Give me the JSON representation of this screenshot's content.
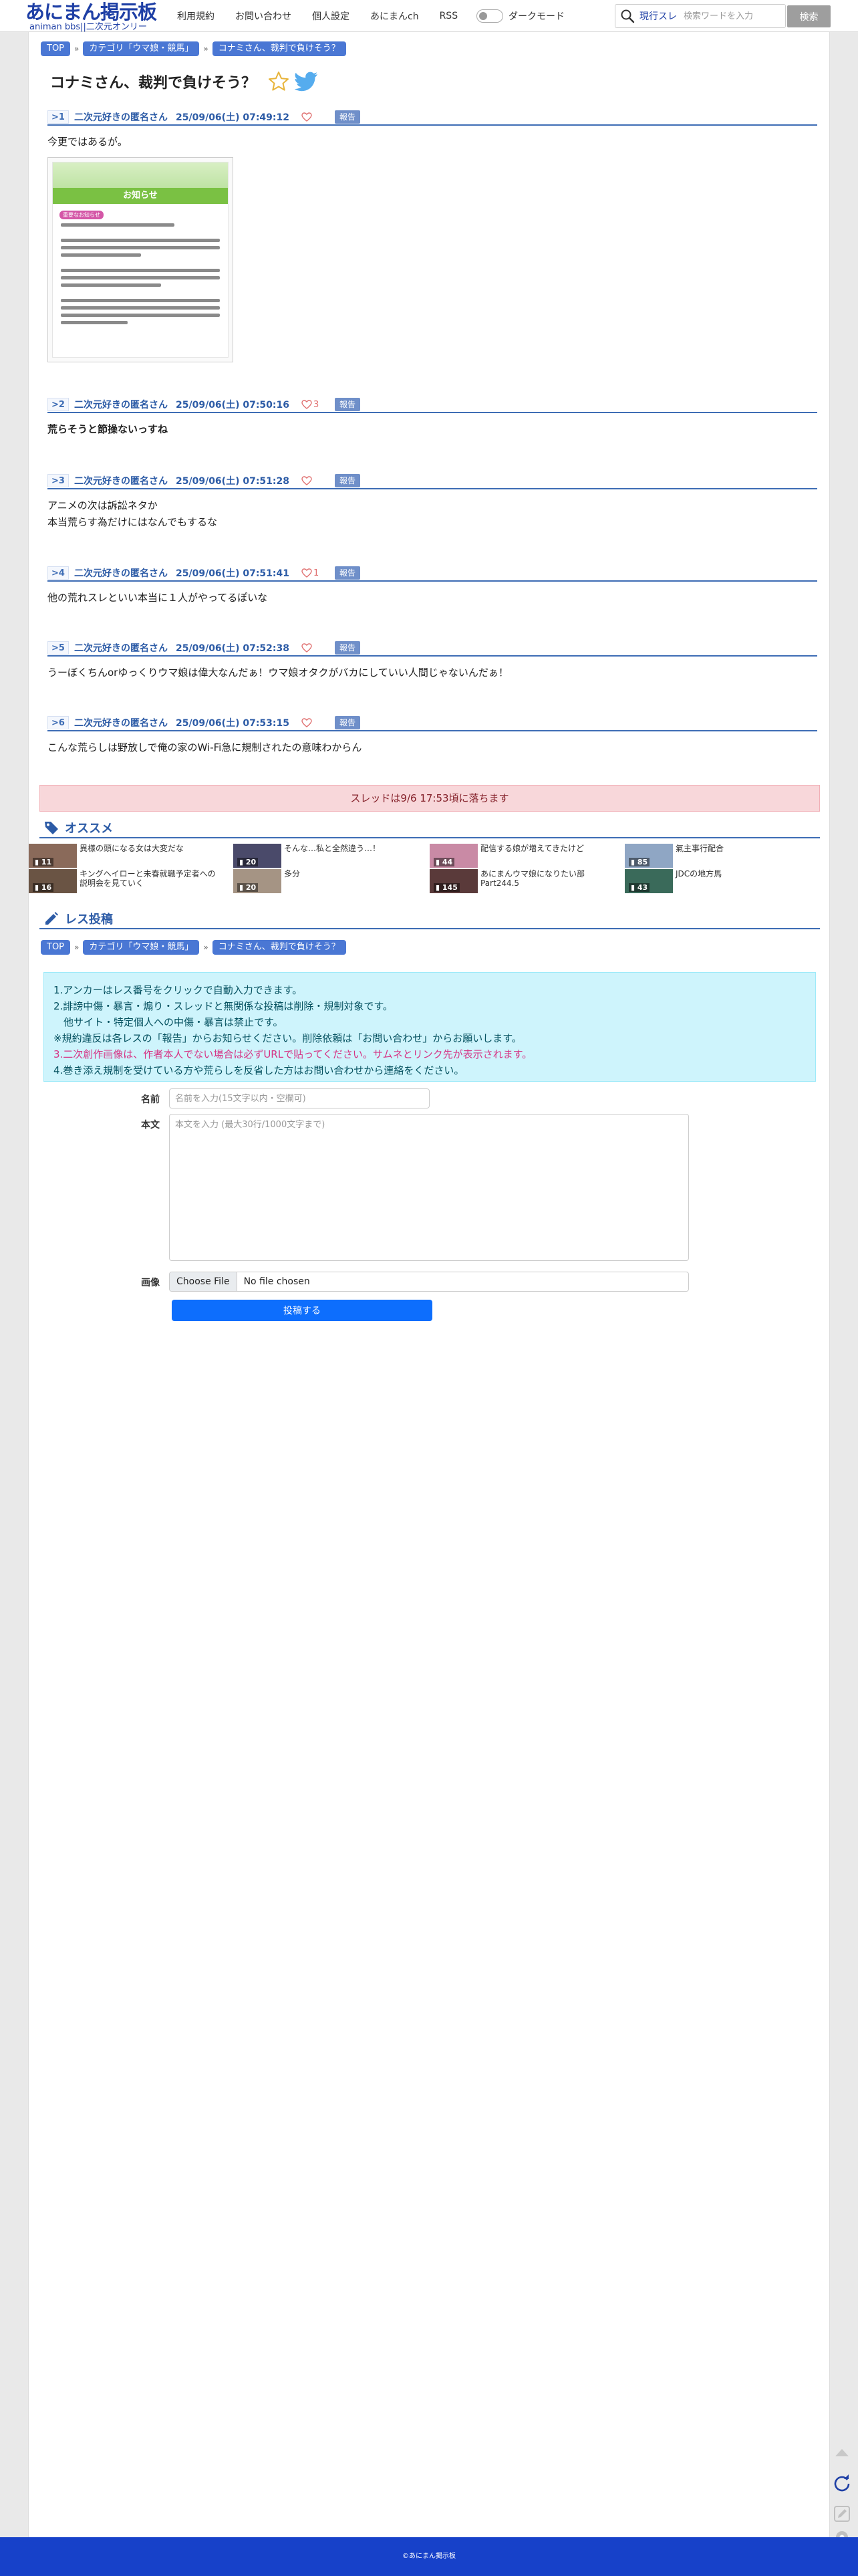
{
  "header": {
    "logo_main": "あにまん掲示板",
    "logo_sub": "animan bbs||二次元オンリー",
    "nav": [
      "利用規約",
      "お問い合わせ",
      "個人設定",
      "あにまんch",
      "RSS"
    ],
    "dark_mode_label": "ダークモード",
    "search_scope": "現行スレ",
    "search_placeholder": "検索ワードを入力",
    "search_button": "検索"
  },
  "breadcrumb": {
    "top": "TOP",
    "category": "カテゴリ「ウマ娘・競馬」",
    "thread": "コナミさん、裁判で負けそう？"
  },
  "thread_title": "コナミさん、裁判で負けそう？",
  "posts": [
    {
      "num": ">1",
      "name": "二次元好きの匿名さん",
      "date": "25/09/06(土) 07:49:12",
      "likes": "",
      "report": "報告",
      "body": "今更ではあるが。",
      "bold": false
    },
    {
      "num": ">2",
      "name": "二次元好きの匿名さん",
      "date": "25/09/06(土) 07:50:16",
      "likes": "3",
      "report": "報告",
      "body": "荒らそうと節操ないっすね",
      "bold": true
    },
    {
      "num": ">3",
      "name": "二次元好きの匿名さん",
      "date": "25/09/06(土) 07:51:28",
      "likes": "",
      "report": "報告",
      "body": "アニメの次は訴訟ネタか\n本当荒らす為だけにはなんでもするな",
      "bold": false
    },
    {
      "num": ">4",
      "name": "二次元好きの匿名さん",
      "date": "25/09/06(土) 07:51:41",
      "likes": "1",
      "report": "報告",
      "body": "他の荒れスレといい本当に１人がやってるぽいな",
      "bold": false
    },
    {
      "num": ">5",
      "name": "二次元好きの匿名さん",
      "date": "25/09/06(土) 07:52:38",
      "likes": "",
      "report": "報告",
      "body": "うーぼくちんorゆっくりウマ娘は偉大なんだぁ！ウマ娘オタクがバカにしていい人間じゃないんだぁ！",
      "bold": false
    },
    {
      "num": ">6",
      "name": "二次元好きの匿名さん",
      "date": "25/09/06(土) 07:53:15",
      "likes": "",
      "report": "報告",
      "body": "こんな荒らしは野放しで俺の家のWi-Fi急に規制されたの意味わからん",
      "bold": false
    }
  ],
  "attachment": {
    "banner": "お知らせ",
    "tag": "重要なお知らせ"
  },
  "notice": "スレッドは9/6 17:53頃に落ちます",
  "recommend": {
    "title": "オススメ",
    "items": [
      {
        "count": "11",
        "text": "異様の頭になる女は大変だな",
        "color": "#8a6a5a"
      },
      {
        "count": "20",
        "text": "そんな…私と全然違う…！",
        "color": "#4a4a6a"
      },
      {
        "count": "44",
        "text": "配信する娘が増えてきたけど",
        "color": "#c98aa5"
      },
      {
        "count": "85",
        "text": "氣主事行配合",
        "color": "#8fa6c4"
      },
      {
        "count": "16",
        "text": "キングヘイローと未春就職予定者への説明会を見ていく",
        "color": "#6a5444"
      },
      {
        "count": "20",
        "text": "多分",
        "color": "#a59484"
      },
      {
        "count": "145",
        "text": "あにまんウマ娘になりたい部Part244.5",
        "color": "#5a3a3a"
      },
      {
        "count": "43",
        "text": "JDCの地方馬",
        "color": "#3a6a5a"
      }
    ]
  },
  "post_form": {
    "title": "レス投稿",
    "rules": [
      "1.アンカーはレス番号をクリックで自動入力できます。",
      "2.誹謗中傷・暴言・煽り・スレッドと無関係な投稿は削除・規制対象です。",
      "　他サイト・特定個人への中傷・暴言は禁止です。",
      "※規約違反は各レスの「報告」からお知らせください。削除依頼は「お問い合わせ」からお願いします。",
      "3.二次創作画像は、作者本人でない場合は必ずURLで貼ってください。サムネとリンク先が表示されます。",
      "4.巻き添え規制を受けている方や荒らしを反省した方はお問い合わせから連絡をください。"
    ],
    "name_label": "名前",
    "name_placeholder": "名前を入力(15文字以内・空欄可)",
    "body_label": "本文",
    "body_placeholder": "本文を入力 (最大30行/1000文字まで)",
    "image_label": "画像",
    "file_button": "Choose File",
    "file_status": "No file chosen",
    "submit": "投稿する"
  },
  "footer": "©あにまん掲示板",
  "colors": {
    "brand": "#1e3fa5",
    "post_accent": "#3e6db5",
    "footer": "#1741c9",
    "chip": "#4a77d4"
  },
  "icons": {
    "favorite": "star-outline-icon",
    "share": "twitter-bird-icon",
    "like": "heart-outline-icon",
    "recommend": "tag-icon",
    "post": "pencil-icon",
    "tools": [
      "scroll-top-icon",
      "refresh-icon",
      "edit-icon",
      "settings-icon"
    ]
  }
}
